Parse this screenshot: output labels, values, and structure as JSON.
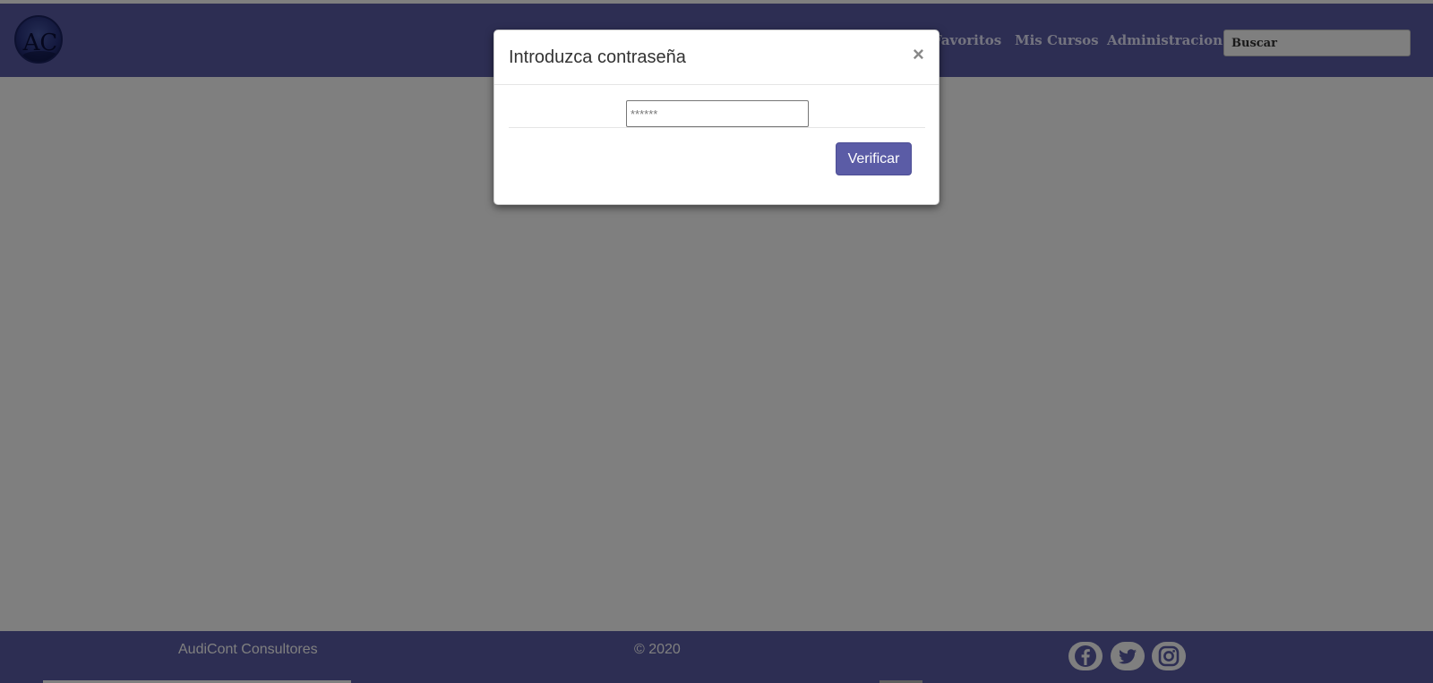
{
  "header": {
    "logo_text": "AC",
    "nav_items": [
      "Favoritos",
      "Mis Cursos",
      "Administracion"
    ],
    "search": {
      "placeholder": "Buscar"
    }
  },
  "modal": {
    "title": "Introduzca contraseña",
    "close_label": "×",
    "password": {
      "placeholder": "******",
      "value": ""
    },
    "verify_label": "Verificar"
  },
  "footer": {
    "company": "AudiCont Consultores",
    "copyright": "© 2020",
    "social_icons": [
      "facebook-icon",
      "twitter-icon",
      "instagram-icon"
    ]
  },
  "colors": {
    "brand": "#5b5ca6",
    "backdrop": "rgba(0,0,0,0.5)",
    "button_text": "#ffffff"
  }
}
